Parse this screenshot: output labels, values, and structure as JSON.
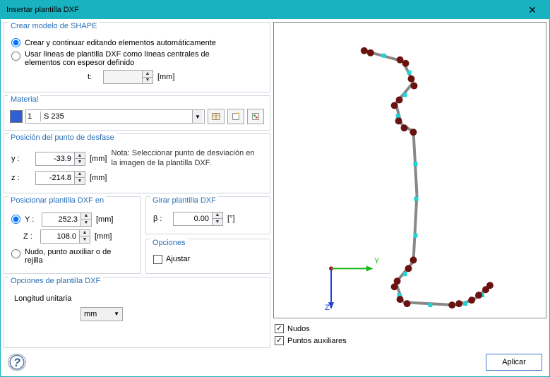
{
  "window": {
    "title": "Insertar plantilla DXF"
  },
  "shape": {
    "title": "Crear modelo de SHAPE",
    "opt_auto": "Crear y continuar editando elementos automáticamente",
    "opt_centerlines": "Usar líneas de plantilla DXF como líneas centrales de elementos con espesor definido",
    "t_label": "t:",
    "t_value": "",
    "t_unit": "[mm]"
  },
  "material": {
    "title": "Material",
    "number": "1",
    "name": "S 235"
  },
  "offset": {
    "title": "Posición del punto de desfase",
    "y_label": "y :",
    "y_value": "-33.9",
    "z_label": "z :",
    "z_value": "-214.8",
    "unit": "[mm]",
    "note": "Nota: Seleccionar punto de desviación en la imagen de la plantilla DXF."
  },
  "position": {
    "title": "Posicionar plantilla DXF en",
    "y_label": "Y :",
    "y_value": "252.3",
    "z_label": "Z :",
    "z_value": "108.0",
    "unit": "[mm]",
    "node_option": "Nudo, punto auxiliar o de rejilla"
  },
  "rotate": {
    "title": "Girar plantilla DXF",
    "beta_label": "β :",
    "beta_value": "0.00",
    "unit": "[°]"
  },
  "options_group": {
    "title": "Opciones",
    "adjust": "Ajustar"
  },
  "dxf_options": {
    "title": "Opciones de plantilla DXF",
    "unit_length_label": "Longitud unitaria",
    "unit_length_value": "mm"
  },
  "preview_checks": {
    "nodes": "Nudos",
    "aux_points": "Puntos auxiliares"
  },
  "axes": {
    "y": "Y",
    "z": "Z"
  },
  "footer": {
    "apply": "Aplicar"
  }
}
